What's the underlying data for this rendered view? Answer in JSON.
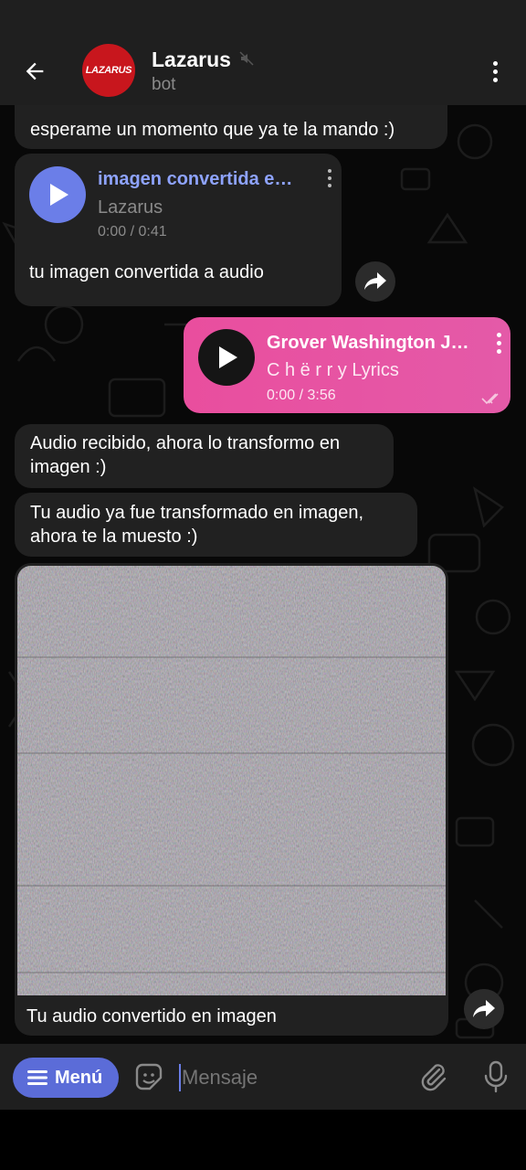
{
  "header": {
    "title": "Lazarus",
    "subtitle": "bot",
    "avatar_text": "LAZARUS"
  },
  "messages": {
    "m1": {
      "text": "esperame un momento que ya te la mando :)"
    },
    "m2": {
      "audio_title": "imagen convertida e…",
      "audio_performer": "Lazarus",
      "audio_time": "0:00 / 0:41",
      "caption": "tu imagen convertida a audio"
    },
    "m3": {
      "audio_title": "Grover Washington J…",
      "audio_performer": "C h ë r r y Lyrics",
      "audio_time": "0:00 / 3:56",
      "status": "read"
    },
    "m4": {
      "text_line1": "Audio recibido, ahora lo transformo en",
      "text_line2": "imagen :)"
    },
    "m5": {
      "text_line1": "Tu audio ya fue transformado en imagen,",
      "text_line2": "ahora te la muesto :)"
    },
    "m6": {
      "caption": "Tu audio convertido en imagen"
    }
  },
  "composer": {
    "menu_label": "Menú",
    "placeholder": "Mensaje"
  },
  "colors": {
    "accent": "#5b6cd8",
    "outgoing_bubble": "#e94e9e",
    "incoming_bubble": "#212121",
    "audio_title": "#8ea3ff"
  },
  "icons": [
    "back-arrow-icon",
    "mute-icon",
    "more-vert-icon",
    "play-icon",
    "share-icon",
    "menu-lines-icon",
    "sticker-icon",
    "attach-icon",
    "mic-icon",
    "read-checks-icon"
  ]
}
